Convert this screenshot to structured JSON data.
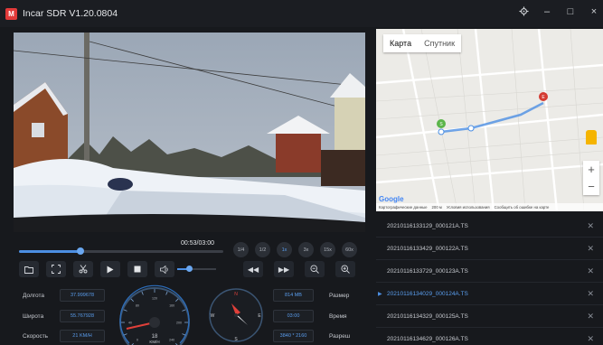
{
  "window": {
    "title": "Incar SDR V1.20.0804",
    "logo": "M",
    "controls": [
      "gear-icon",
      "minimize-icon",
      "maximize-icon",
      "close-icon"
    ]
  },
  "player": {
    "time": "00:53/03:00",
    "progress": 0.3,
    "volume": 0.3,
    "speeds": [
      "1/4",
      "1/2",
      "1x",
      "3x",
      "15x",
      "60x"
    ],
    "active_speed": "1x",
    "controls": [
      "folder-icon",
      "fullscreen-icon",
      "cut-icon",
      "play-icon",
      "stop-icon",
      "volume-icon"
    ],
    "nav_controls": [
      "rewind-icon",
      "forward-icon",
      "zoom-out-icon",
      "zoom-in-icon"
    ]
  },
  "info": {
    "lon_label": "Долгота",
    "lon": "37.999678",
    "lat_label": "Широта",
    "lat": "55.767928",
    "speed_label": "Скорость",
    "speed": "21 KM/H",
    "size_label": "Размер",
    "size": "814 MB",
    "time_label": "Время",
    "time": "03:00",
    "res_label": "Разреш",
    "res": "3840 * 2160"
  },
  "speedometer": {
    "value": "18",
    "unit": "KM/H",
    "ticks": [
      "0",
      "20",
      "40",
      "60",
      "80",
      "100",
      "120",
      "140",
      "160",
      "180",
      "200",
      "220",
      "240"
    ]
  },
  "compass": {
    "letters": [
      "N",
      "E",
      "S",
      "W"
    ]
  },
  "map": {
    "tabs": [
      "Карта",
      "Спутник"
    ],
    "active_tab": "Карта",
    "logo": "Google",
    "footer": [
      "Картографические данные",
      "200 м",
      "Условия использования",
      "Сообщить об ошибке на карте"
    ],
    "start_marker": "S",
    "end_marker": "E"
  },
  "files": [
    {
      "name": "20210116133129_000121A.TS",
      "active": false
    },
    {
      "name": "20210116133429_000122A.TS",
      "active": false
    },
    {
      "name": "20210116133729_000123A.TS",
      "active": false
    },
    {
      "name": "20210116134029_000124A.TS",
      "active": true
    },
    {
      "name": "20210116134329_000125A.TS",
      "active": false
    },
    {
      "name": "20210116134629_000126A.TS",
      "active": false
    }
  ]
}
